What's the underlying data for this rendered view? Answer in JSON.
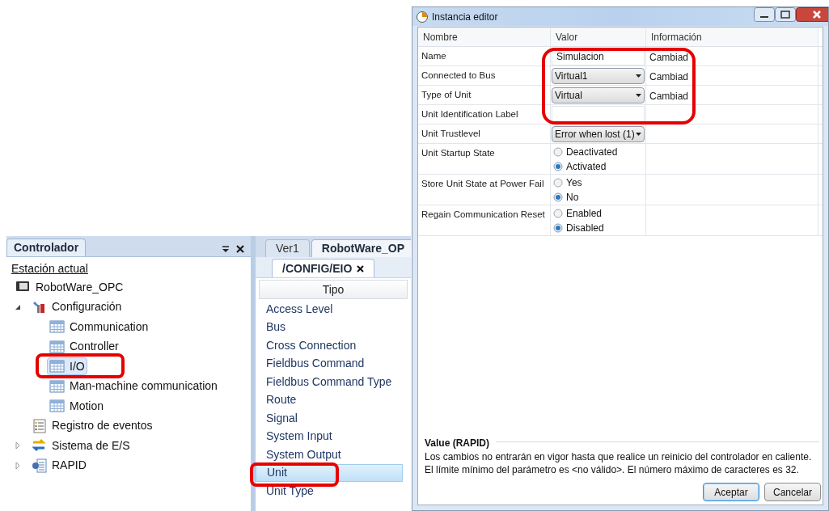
{
  "controller_panel": {
    "tab": "Controlador",
    "link": "Estación actual",
    "tree": [
      {
        "label": "RobotWare_OPC",
        "kind": "station",
        "selected": false,
        "children": [
          {
            "label": "Configuración",
            "kind": "config",
            "expanded": true,
            "selected": false,
            "children": [
              {
                "label": "Communication",
                "kind": "table",
                "selected": false
              },
              {
                "label": "Controller",
                "kind": "table",
                "selected": false
              },
              {
                "label": "I/O",
                "kind": "table",
                "selected": true
              },
              {
                "label": "Man-machine communication",
                "kind": "table",
                "selected": false
              },
              {
                "label": "Motion",
                "kind": "table",
                "selected": false
              }
            ]
          },
          {
            "label": "Registro de eventos",
            "kind": "log",
            "selected": false
          },
          {
            "label": "Sistema de E/S",
            "kind": "io",
            "expanded": false,
            "selected": false
          },
          {
            "label": "RAPID",
            "kind": "program",
            "expanded": false,
            "selected": false
          }
        ]
      }
    ]
  },
  "config_panel": {
    "tabs": [
      {
        "label": "Ver1",
        "selected": false
      },
      {
        "label": "RobotWare_OP",
        "selected": true
      }
    ],
    "document_tab": "/CONFIG/EIO",
    "column": "Tipo",
    "items": [
      {
        "label": "Access Level",
        "selected": false
      },
      {
        "label": "Bus",
        "selected": false
      },
      {
        "label": "Cross Connection",
        "selected": false
      },
      {
        "label": "Fieldbus Command",
        "selected": false
      },
      {
        "label": "Fieldbus Command Type",
        "selected": false
      },
      {
        "label": "Route",
        "selected": false
      },
      {
        "label": "Signal",
        "selected": false
      },
      {
        "label": "System Input",
        "selected": false
      },
      {
        "label": "System Output",
        "selected": false
      },
      {
        "label": "Unit",
        "selected": true
      },
      {
        "label": "Unit Type",
        "selected": false
      }
    ]
  },
  "dialog": {
    "title": "Instancia editor",
    "columns": [
      "Nombre",
      "Valor",
      "Información"
    ],
    "rows": [
      {
        "name": "Name",
        "kind": "text",
        "value": "Simulacion",
        "info": "Cambiad"
      },
      {
        "name": "Connected to Bus",
        "kind": "dropdown",
        "value": "Virtual1",
        "info": "Cambiad"
      },
      {
        "name": "Type of Unit",
        "kind": "dropdown",
        "value": "Virtual",
        "info": "Cambiad"
      },
      {
        "name": "Unit Identification Label",
        "kind": "text"
      },
      {
        "name": "Unit Trustlevel",
        "kind": "dropdown",
        "value": "Error when lost (1)"
      },
      {
        "name": "Unit Startup State",
        "kind": "radio",
        "options": [
          {
            "label": "Deactivated",
            "selected": false
          },
          {
            "label": "Activated",
            "selected": true
          }
        ]
      },
      {
        "name": "Store Unit State at Power Fail",
        "kind": "radio",
        "options": [
          {
            "label": "Yes",
            "selected": false
          },
          {
            "label": "No",
            "selected": true
          }
        ]
      },
      {
        "name": "Regain Communication Reset",
        "kind": "radio",
        "options": [
          {
            "label": "Enabled",
            "selected": false
          },
          {
            "label": "Disabled",
            "selected": true
          }
        ]
      }
    ],
    "description": {
      "title": "Value (RAPID)",
      "lines": [
        "Los cambios no entrarán en vigor hasta que realice un reinicio del controlador en caliente.",
        "El límite mínimo del parámetro es <no válido>. El número máximo de caracteres es 32."
      ]
    },
    "buttons": [
      {
        "label": "Aceptar",
        "default": true
      },
      {
        "label": "Cancelar",
        "default": false
      }
    ]
  }
}
